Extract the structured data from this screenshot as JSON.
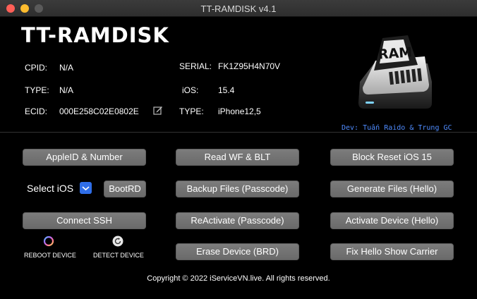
{
  "window": {
    "title": "TT-RAMDISK v4.1"
  },
  "app": {
    "title": "TT-RAMDISK",
    "dev_credit": "Dev: Tuấn Raido & Trung GC"
  },
  "device_info": {
    "cpid_label": "CPID:",
    "cpid_value": "N/A",
    "type_label": "TYPE:",
    "type_value": "N/A",
    "ecid_label": "ECID:",
    "ecid_value": "000E258C02E0802E",
    "serial_label": "SERIAL:",
    "serial_value": "FK1Z95H4N70V",
    "ios_label": "iOS:",
    "ios_value": "15.4",
    "model_label": "TYPE:",
    "model_value": "iPhone12,5"
  },
  "drive_icon_text": "RAM",
  "buttons": {
    "appleid": "AppleID & Number",
    "bootrd": "BootRD",
    "connect_ssh": "Connect SSH",
    "read_wf": "Read WF & BLT",
    "backup_files": "Backup Files (Passcode)",
    "reactivate": "ReActivate (Passcode)",
    "erase_device": "Erase Device (BRD)",
    "block_reset": "Block Reset iOS 15",
    "generate_files": "Generate Files (Hello)",
    "activate_device": "Activate Device (Hello)",
    "fix_hello": "Fix Hello Show Carrier"
  },
  "ios_select": {
    "selected": "Select iOS"
  },
  "tools": {
    "reboot_label": "REBOOT DEVICE",
    "detect_label": "DETECT DEVICE"
  },
  "footer": {
    "copyright": "Copyright © 2022 iServiceVN.live. All rights reserved."
  },
  "colors": {
    "accent": "#2f6ee8",
    "credit": "#4f8cff",
    "button": "#737373",
    "background": "#000000"
  },
  "icons": [
    "edit-icon",
    "ram-drive-icon",
    "chevron-down-icon",
    "reboot-icon",
    "detect-icon"
  ]
}
